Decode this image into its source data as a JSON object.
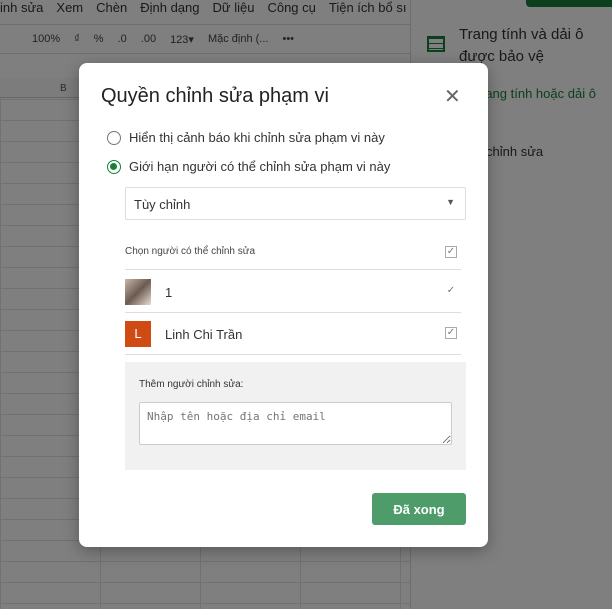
{
  "menu": [
    "inh sửa",
    "Xem",
    "Chèn",
    "Định dạng",
    "Dữ liệu",
    "Công cụ",
    "Tiện ích bổ sı"
  ],
  "toolbar": {
    "zoom": "100%",
    "currency": "₫",
    "percent": "%",
    "dec_less": ".0",
    "dec_more": ".00",
    "format": "123▾",
    "font": "Mặc định (...",
    "more": "•••"
  },
  "column_b": "B",
  "side_panel": {
    "title": "Trang tính và dải ô được bảo vệ",
    "link": "rang tính hoặc dải ô",
    "item": "chỉnh sửa"
  },
  "dialog": {
    "title": "Quyền chỉnh sửa phạm vi",
    "option_warn": "Hiển thị cảnh báo khi chỉnh sửa phạm vi này",
    "option_restrict": "Giới hạn người có thể chỉnh sửa phạm vi này",
    "selected_option": "restrict",
    "select_value": "Tùy chỉnh",
    "editors_header": "Chọn người có thể chỉnh sửa",
    "editors": [
      {
        "name": "1",
        "checked": true
      },
      {
        "name": "Linh Chi Trần",
        "initial": "L",
        "checked": true
      }
    ],
    "add_label": "Thêm người chỉnh sửa:",
    "add_placeholder": "Nhập tên hoặc địa chỉ email",
    "done": "Đã xong"
  }
}
